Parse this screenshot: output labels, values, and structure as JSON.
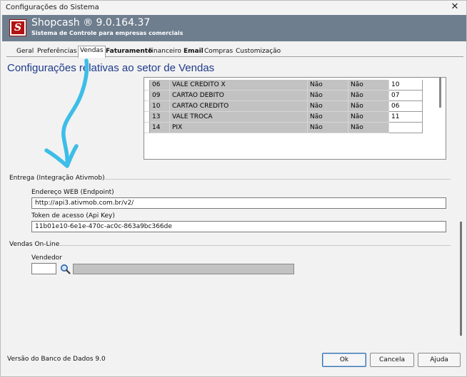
{
  "window": {
    "title": "Configurações do Sistema",
    "close_glyph": "✕"
  },
  "app": {
    "logo_glyph": "S",
    "name": "Shopcash ® 9.0.164.37",
    "subtitle": "Sistema de Controle para empresas comerciais"
  },
  "tabs": [
    {
      "label": "Geral",
      "active": false,
      "bold": false
    },
    {
      "label": "Preferências",
      "active": false,
      "bold": false
    },
    {
      "label": "Vendas",
      "active": true,
      "bold": false
    },
    {
      "label": "Faturamento",
      "active": false,
      "bold": true
    },
    {
      "label": "Financeiro",
      "active": false,
      "bold": false
    },
    {
      "label": "Email",
      "active": false,
      "bold": true
    },
    {
      "label": "Compras",
      "active": false,
      "bold": false
    },
    {
      "label": "Customização",
      "active": false,
      "bold": false
    }
  ],
  "page": {
    "heading": "Configurações relativas ao setor de Vendas"
  },
  "payment_table": {
    "rows": [
      {
        "code": "06",
        "name": "VALE CREDITO X",
        "col3": "Não",
        "col4": "Não",
        "col5": "10"
      },
      {
        "code": "09",
        "name": "CARTAO DEBITO",
        "col3": "Não",
        "col4": "Não",
        "col5": "07"
      },
      {
        "code": "10",
        "name": "CARTAO CREDITO",
        "col3": "Não",
        "col4": "Não",
        "col5": "06"
      },
      {
        "code": "13",
        "name": "VALE TROCA",
        "col3": "Não",
        "col4": "Não",
        "col5": "11"
      },
      {
        "code": "14",
        "name": "PIX",
        "col3": "Não",
        "col4": "Não",
        "col5": ""
      }
    ]
  },
  "delivery": {
    "section_title": "Entrega (Integração Ativmob)",
    "endpoint_label": "Endereço WEB (Endpoint)",
    "endpoint_value": "http://api3.ativmob.com.br/v2/",
    "token_label": "Token de acesso (Api Key)",
    "token_value": "11b01e10-6e1e-470c-ac0c-863a9bc366de"
  },
  "online_sales": {
    "section_title": "Vendas On-Line",
    "seller_label": "Vendedor",
    "seller_code": "",
    "seller_name": ""
  },
  "footer": {
    "db_version": "Versão do Banco de Dados 9.0",
    "ok_label": "Ok",
    "cancel_label": "Cancela",
    "help_label": "Ajuda"
  },
  "colors": {
    "accent": "#1f3a8a",
    "header": "#6e7e8e",
    "annotation_arrow": "#3dbde8",
    "grid_row": "#c2c2c2"
  },
  "icons": {
    "close": "close-icon",
    "logo": "shopcash-logo-icon",
    "search": "magnifier-search-icon",
    "annotation": "arrow-down-annotation-icon"
  }
}
